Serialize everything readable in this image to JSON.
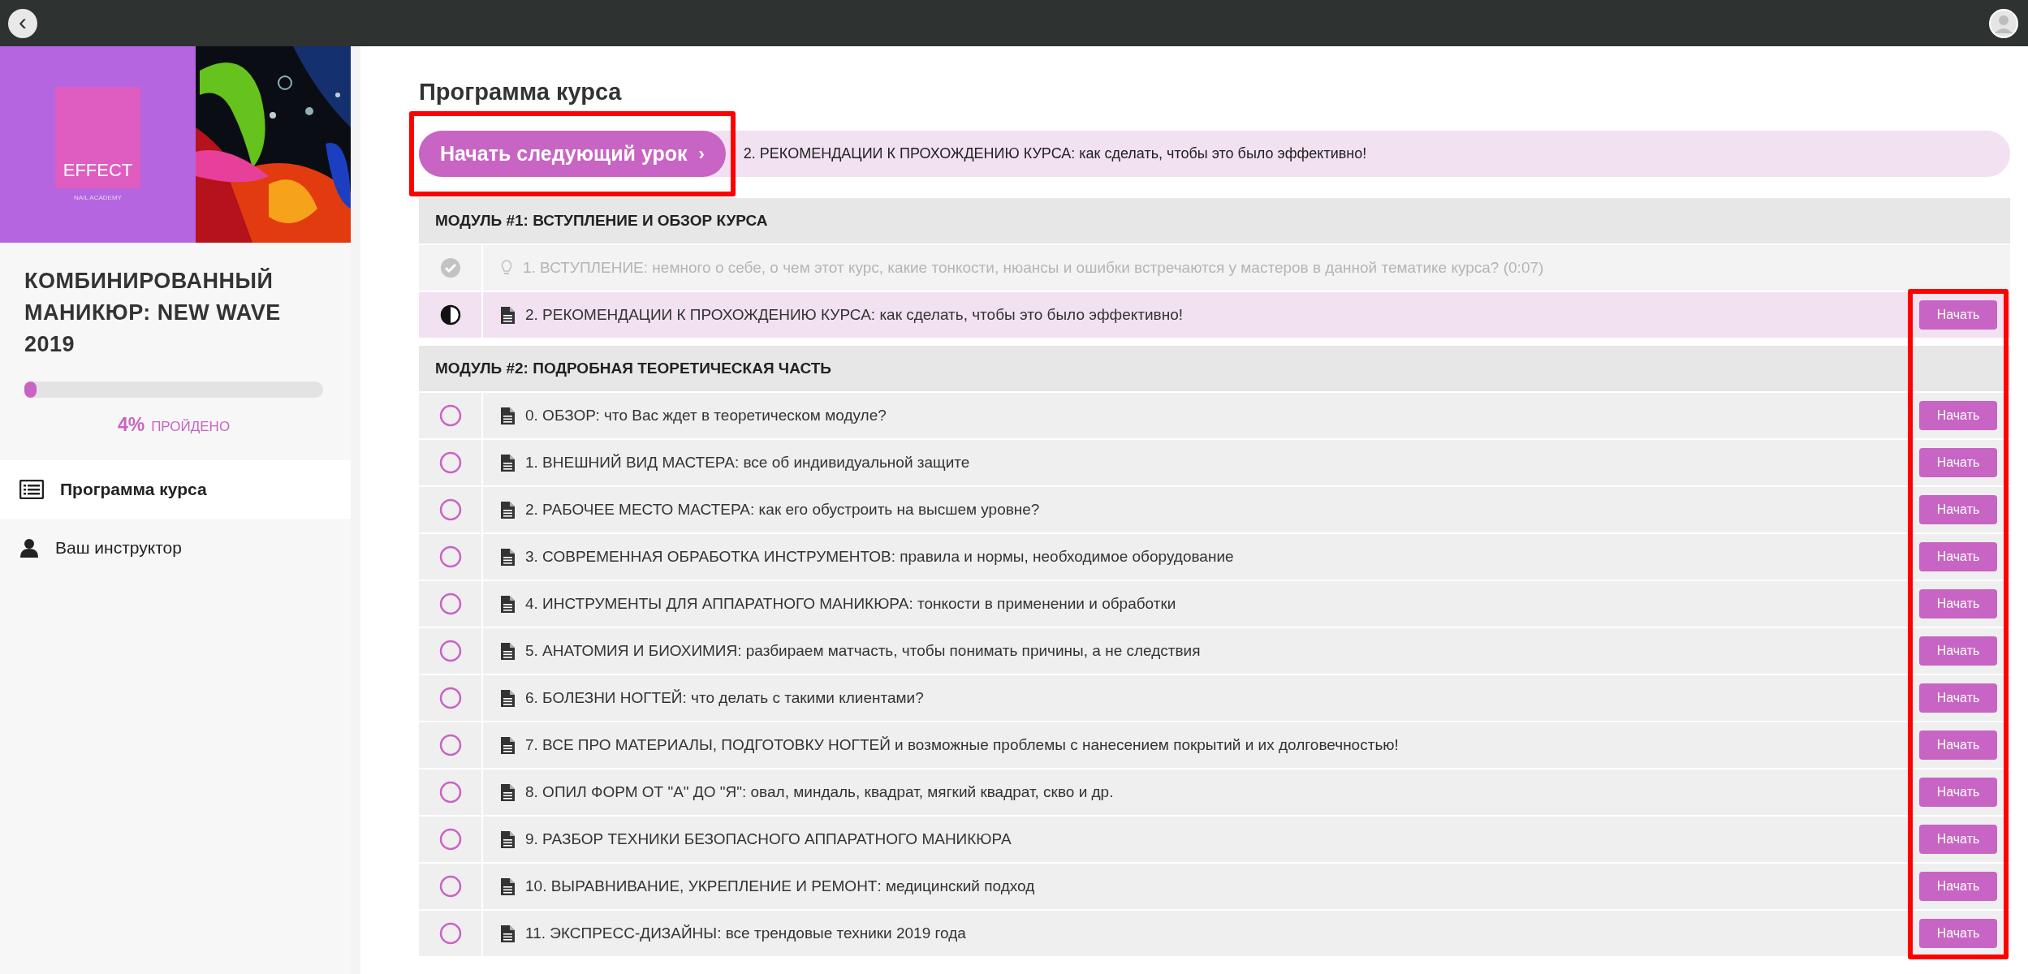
{
  "top_bar": {
    "back_button": "‹"
  },
  "sidebar": {
    "logo": {
      "name": "EFFECT",
      "subtitle": "NAIL ACADEMY"
    },
    "course_title": "КОМБИНИРОВАННЫЙ МАНИКЮР: NEW WAVE 2019",
    "progress": {
      "level": 0.04,
      "percent": "4%",
      "label": "ПРОЙДЕНО"
    },
    "items": [
      {
        "label": "Программа курса",
        "kind": "list",
        "selected": true
      },
      {
        "label": "Ваш инструктор",
        "kind": "person",
        "selected": false
      }
    ]
  },
  "main": {
    "title": "Программа курса",
    "start_buttons_highlighted": true,
    "next_lesson": {
      "highlighted": true,
      "button": "Начать следующий урок",
      "arrow": "›",
      "lesson": "2. РЕКОМЕНДАЦИИ К ПРОХОЖДЕНИЮ КУРСА: как сделать, чтобы это было эффективно!"
    },
    "modules": [
      {
        "title": "МОДУЛЬ #1: ВСТУПЛЕНИЕ И ОБЗОР КУРСА",
        "lessons": [
          {
            "completed": true,
            "kind": "video",
            "title": "1. ВСТУПЛЕНИЕ: немного о себе, о чем этот курс, какие тонкости, нюансы и ошибки встречаются у мастеров в данной тематике курса? (0:07)"
          },
          {
            "completed": false,
            "started": true,
            "kind": "text",
            "title": "2. РЕКОМЕНДАЦИИ К ПРОХОЖДЕНИЮ КУРСА: как сделать, чтобы это было эффективно!",
            "button": "Начать"
          }
        ]
      },
      {
        "title": "МОДУЛЬ #2: ПОДРОБНАЯ ТЕОРЕТИЧЕСКАЯ ЧАСТЬ",
        "lessons": [
          {
            "completed": false,
            "started": false,
            "kind": "text",
            "title": "0. ОБЗОР: что Вас ждет в теоретическом модуле?",
            "button": "Начать"
          },
          {
            "completed": false,
            "started": false,
            "kind": "text",
            "title": "1. ВНЕШНИЙ ВИД МАСТЕРА: все об индивидуальной защите",
            "button": "Начать"
          },
          {
            "completed": false,
            "started": false,
            "kind": "text",
            "title": "2. РАБОЧЕЕ МЕСТО МАСТЕРА: как его обустроить на высшем уровне?",
            "button": "Начать"
          },
          {
            "completed": false,
            "started": false,
            "kind": "text",
            "title": "3. СОВРЕМЕННАЯ ОБРАБОТКА ИНСТРУМЕНТОВ: правила и нормы, необходимое оборудование",
            "button": "Начать"
          },
          {
            "completed": false,
            "started": false,
            "kind": "text",
            "title": "4. ИНСТРУМЕНТЫ ДЛЯ АППАРАТНОГО МАНИКЮРА: тонкости в применении и обработки",
            "button": "Начать"
          },
          {
            "completed": false,
            "started": false,
            "kind": "text",
            "title": "5. АНАТОМИЯ И БИОХИМИЯ: разбираем матчасть, чтобы понимать причины, а не следствия",
            "button": "Начать"
          },
          {
            "completed": false,
            "started": false,
            "kind": "text",
            "title": "6. БОЛЕЗНИ НОГТЕЙ: что делать с такими клиентами?",
            "button": "Начать"
          },
          {
            "completed": false,
            "started": false,
            "kind": "text",
            "title": "7. ВСЕ ПРО МАТЕРИАЛЫ, ПОДГОТОВКУ НОГТЕЙ и возможные проблемы с нанесением покрытий и их долговечностью!",
            "button": "Начать"
          },
          {
            "completed": false,
            "started": false,
            "kind": "text",
            "title": "8. ОПИЛ ФОРМ ОТ \"А\" ДО \"Я\": овал, миндаль, квадрат, мягкий квадрат, скво и др.",
            "button": "Начать"
          },
          {
            "completed": false,
            "started": false,
            "kind": "text",
            "title": "9. РАЗБОР ТЕХНИКИ БЕЗОПАСНОГО АППАРАТНОГО МАНИКЮРА",
            "button": "Начать"
          },
          {
            "completed": false,
            "started": false,
            "kind": "text",
            "title": "10. ВЫРАВНИВАНИЕ, УКРЕПЛЕНИЕ И РЕМОНТ: медицинский подход",
            "button": "Начать"
          },
          {
            "completed": false,
            "started": false,
            "kind": "text",
            "title": "11. ЭКСПРЕСС-ДИЗАЙНЫ: все трендовые техники 2019 года",
            "button": "Начать"
          }
        ]
      }
    ]
  }
}
